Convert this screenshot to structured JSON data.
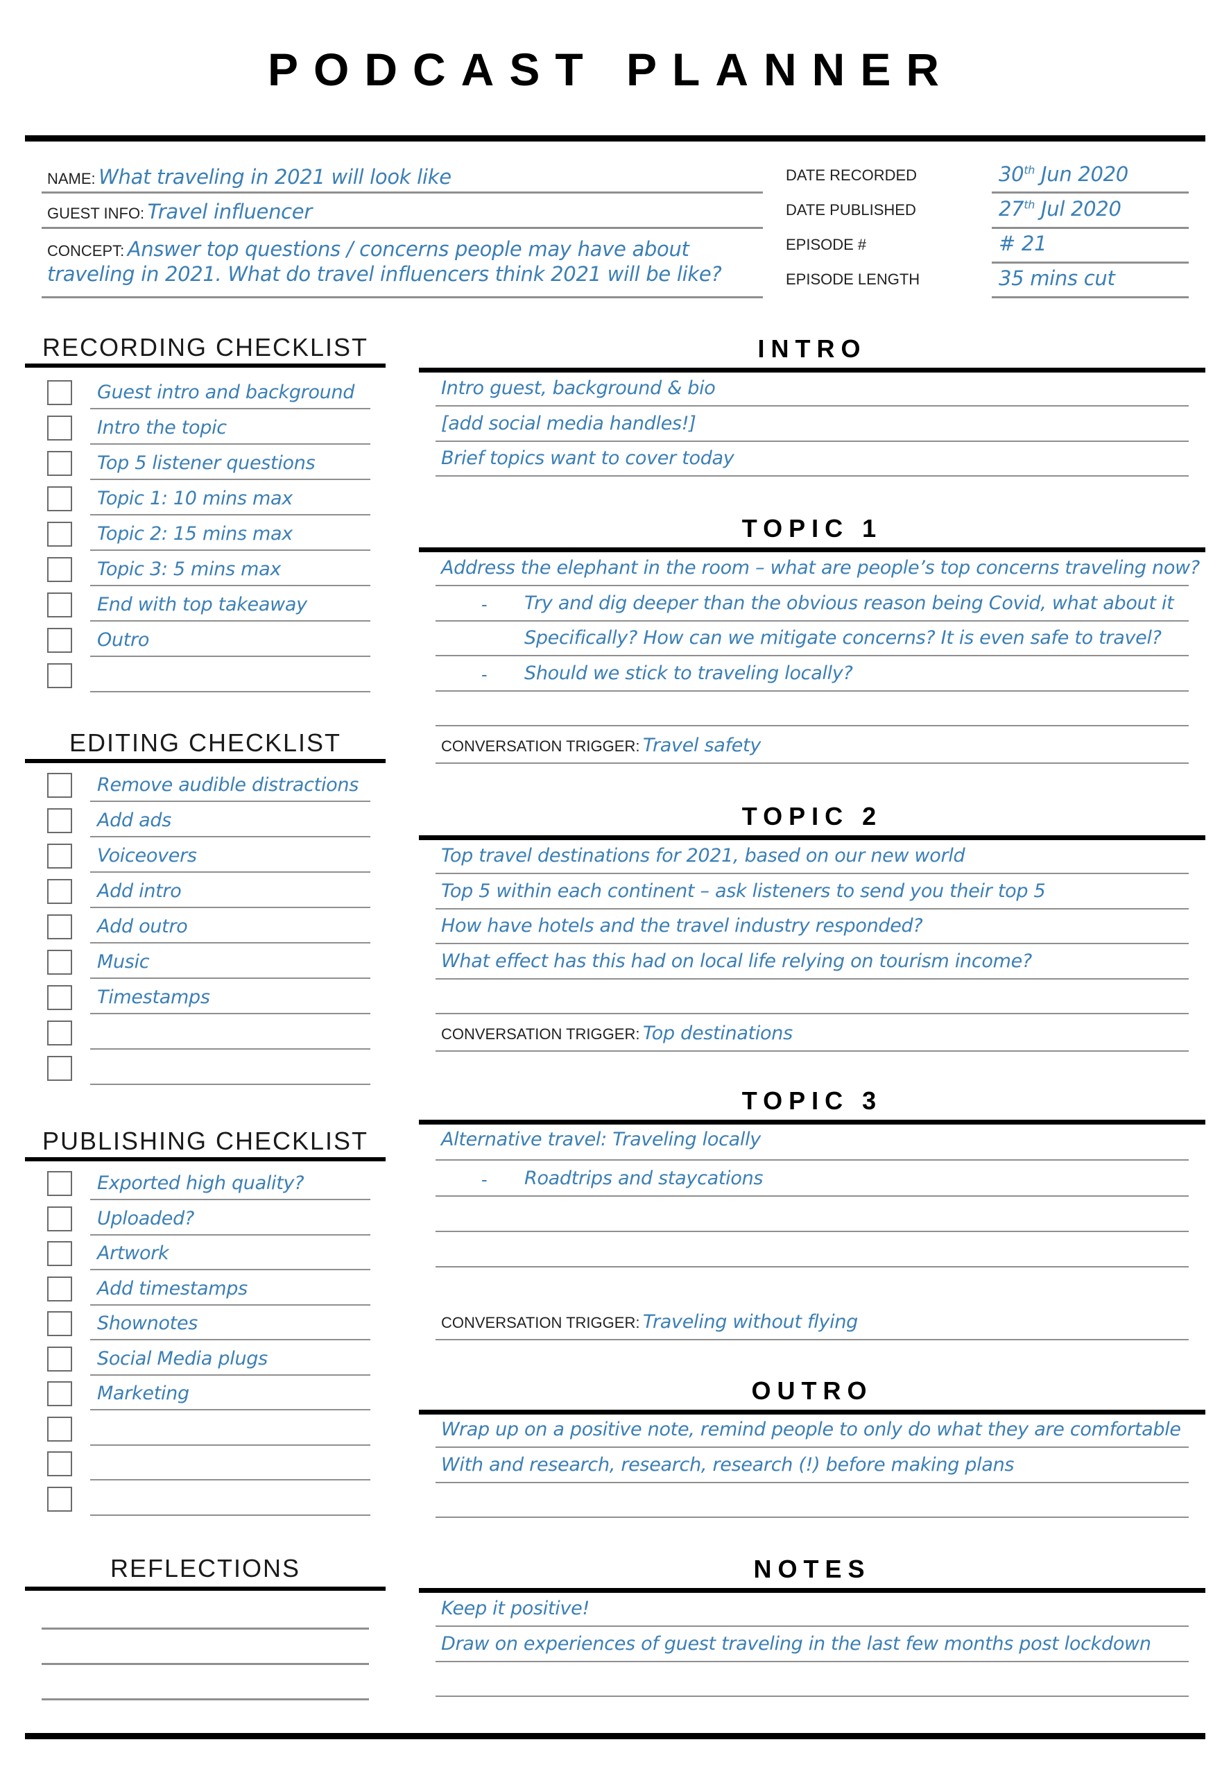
{
  "header": {
    "title": "PODCAST PLANNER"
  },
  "episode_info": {
    "name_label": "NAME:",
    "name_value": "What traveling in 2021 will look like",
    "guest_label": "GUEST INFO:",
    "guest_value": "Travel influencer",
    "concept_label": "CONCEPT:",
    "concept_line1": "Answer top questions / concerns people may have about",
    "concept_line2": "traveling in 2021. What do travel influencers think 2021 will be like?",
    "date_recorded_label": "DATE RECORDED",
    "date_recorded_day": "30",
    "date_recorded_suffix": "th",
    "date_recorded_rest": " Jun 2020",
    "date_published_label": "DATE PUBLISHED",
    "date_published_day": "27",
    "date_published_suffix": "th",
    "date_published_rest": " Jul 2020",
    "episode_number_label": "EPISODE #",
    "episode_number_value": "# 21",
    "episode_length_label": "EPISODE LENGTH",
    "episode_length_value": "35 mins cut"
  },
  "recording_checklist": {
    "title": "RECORDING CHECKLIST",
    "items": [
      {
        "label": "Guest intro and background",
        "checked": false
      },
      {
        "label": "Intro the topic",
        "checked": false
      },
      {
        "label": "Top 5 listener questions",
        "checked": false
      },
      {
        "label": "Topic 1: 10 mins max",
        "checked": false
      },
      {
        "label": "Topic 2: 15 mins max",
        "checked": false
      },
      {
        "label": "Topic 3: 5 mins max",
        "checked": false
      },
      {
        "label": "End with top takeaway",
        "checked": false
      },
      {
        "label": "Outro",
        "checked": false
      },
      {
        "label": "",
        "checked": false
      }
    ]
  },
  "editing_checklist": {
    "title": "EDITING CHECKLIST",
    "items": [
      {
        "label": "Remove audible distractions",
        "checked": false
      },
      {
        "label": "Add ads",
        "checked": false
      },
      {
        "label": "Voiceovers",
        "checked": false
      },
      {
        "label": "Add intro",
        "checked": false
      },
      {
        "label": "Add outro",
        "checked": false
      },
      {
        "label": "Music",
        "checked": false
      },
      {
        "label": "Timestamps",
        "checked": false
      },
      {
        "label": "",
        "checked": false
      },
      {
        "label": "",
        "checked": false
      }
    ]
  },
  "publishing_checklist": {
    "title": "PUBLISHING CHECKLIST",
    "items": [
      {
        "label": "Exported high quality?",
        "checked": false
      },
      {
        "label": "Uploaded?",
        "checked": false
      },
      {
        "label": "Artwork",
        "checked": false
      },
      {
        "label": "Add timestamps",
        "checked": false
      },
      {
        "label": "Shownotes",
        "checked": false
      },
      {
        "label": "Social Media plugs",
        "checked": false
      },
      {
        "label": "Marketing",
        "checked": false
      },
      {
        "label": "",
        "checked": false
      },
      {
        "label": "",
        "checked": false
      },
      {
        "label": "",
        "checked": false
      }
    ]
  },
  "reflections": {
    "title": "REFLECTIONS",
    "lines": [
      "",
      "",
      ""
    ]
  },
  "intro": {
    "title": "INTRO",
    "lines": [
      "Intro guest, background & bio",
      "[add social media handles!]",
      "Brief topics want to cover today"
    ]
  },
  "topic1": {
    "title": "TOPIC 1",
    "lines": [
      {
        "bullet": "",
        "text": "Address the elephant in the room – what are people’s top concerns traveling now?"
      },
      {
        "bullet": "-",
        "text": "Try and dig deeper than the obvious reason being Covid, what about it"
      },
      {
        "bullet": "",
        "text": "Specifically? How can we mitigate concerns? It is even safe to travel?",
        "indent": true
      },
      {
        "bullet": "-",
        "text": "Should we stick to traveling locally?"
      },
      {
        "bullet": "",
        "text": ""
      }
    ],
    "trigger_label": "CONVERSATION TRIGGER:",
    "trigger_value": "Travel safety"
  },
  "topic2": {
    "title": "TOPIC 2",
    "lines": [
      "Top travel destinations for 2021, based on our new world",
      "Top 5 within each continent – ask listeners to send you their top 5",
      "How have hotels and the travel industry responded?",
      "What effect has this had on local life relying on tourism income?",
      ""
    ],
    "trigger_label": "CONVERSATION TRIGGER:",
    "trigger_value": "Top destinations"
  },
  "topic3": {
    "title": "TOPIC 3",
    "lines": [
      {
        "bullet": "",
        "text": "Alternative travel: Traveling locally"
      },
      {
        "bullet": "-",
        "text": "Roadtrips and staycations"
      },
      {
        "bullet": "",
        "text": ""
      },
      {
        "bullet": "",
        "text": ""
      }
    ],
    "trigger_label": "CONVERSATION TRIGGER:",
    "trigger_value": "Traveling without flying"
  },
  "outro": {
    "title": "OUTRO",
    "lines": [
      "Wrap up on a positive note, remind people to only do what they are comfortable",
      "With and research, research, research (!) before making plans",
      ""
    ]
  },
  "notes": {
    "title": "NOTES",
    "lines": [
      "Keep it positive!",
      "Draw on experiences of guest traveling in the last few months post lockdown",
      ""
    ]
  },
  "colors": {
    "ink": "#3b7fb5",
    "rule": "#000000",
    "underline": "#8f8f8f"
  }
}
